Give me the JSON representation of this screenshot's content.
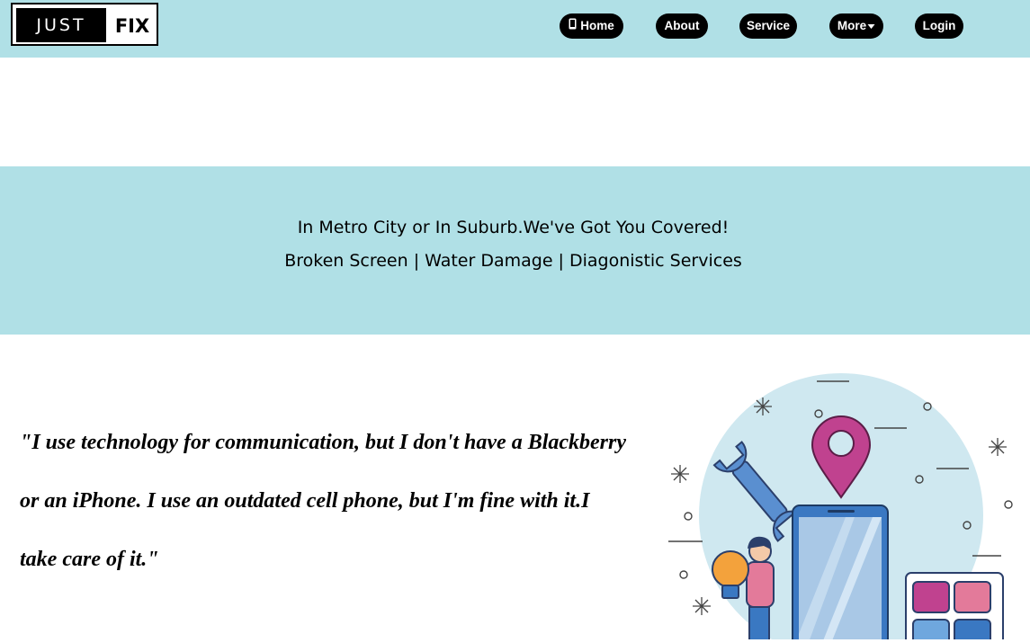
{
  "brand": {
    "left": "JUST",
    "right": "FIX"
  },
  "nav": {
    "items": [
      {
        "label": "Home",
        "icon": "phone-icon"
      },
      {
        "label": "About"
      },
      {
        "label": "Service"
      },
      {
        "label": "More",
        "icon": "caret-down-icon"
      },
      {
        "label": "Login"
      }
    ]
  },
  "banner": {
    "line1": "In Metro City or In Suburb.We've Got You Covered!",
    "line2": "Broken Screen | Water Damage | Diagonistic Services"
  },
  "quote": {
    "text": "\"I use technology for communication, but I don't have a Blackberry or an iPhone. I use an outdated cell phone, but I'm fine with it.I take care of it.\""
  },
  "colors": {
    "header_bg": "#b0e0e6",
    "banner_bg": "#b0e0e6",
    "button_bg": "#000000",
    "illustration_circle": "#cfe8f0",
    "pin": "#c0428f",
    "phone": "#3a78c2"
  }
}
